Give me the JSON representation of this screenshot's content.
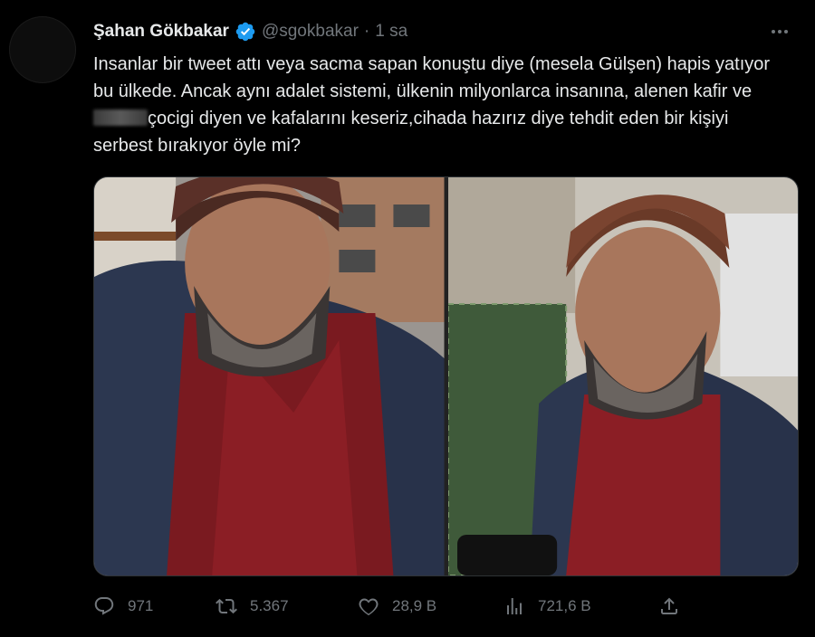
{
  "tweet": {
    "author_name": "Şahan Gökbakar",
    "handle": "@sgokbakar",
    "separator": "·",
    "time": "1 sa",
    "text_part1": "Insanlar bir tweet attı veya sacma sapan konuştu diye (mesela Gülşen) hapis yatıyor bu ülkede. Ancak aynı adalet sistemi, ülkenin milyonlarca insanına, alenen kafir ve",
    "text_part2": "çocigi diyen ve kafalarını keseriz,cihada hazırız diye tehdit eden bir kişiyi serbest bırakıyor öyle mi?"
  },
  "stats": {
    "replies": "971",
    "retweets": "5.367",
    "likes": "28,9 B",
    "views": "721,6 B"
  },
  "icons": {
    "verified": "verified-badge-icon",
    "more": "more-icon",
    "reply": "reply-icon",
    "retweet": "retweet-icon",
    "like": "heart-icon",
    "views": "views-icon",
    "share": "share-icon"
  },
  "colors": {
    "background": "#000000",
    "text": "#e7e9ea",
    "muted": "#71767b",
    "verified": "#1d9bf0"
  }
}
